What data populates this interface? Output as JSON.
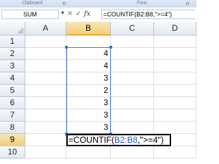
{
  "ribbon": {
    "group_left": "Clipboard",
    "group_mid": "Font"
  },
  "formula_bar": {
    "name_box": "SUM",
    "cancel_glyph": "✕",
    "enter_glyph": "✓",
    "fx_label": "fx",
    "formula": "=COUNTIF(B2:B8,\">=4\")"
  },
  "columns": [
    "A",
    "B",
    "C",
    "D"
  ],
  "rows": [
    "1",
    "2",
    "3",
    "4",
    "5",
    "6",
    "7",
    "8",
    "9",
    "10"
  ],
  "cells": {
    "B2": "4",
    "B3": "4",
    "B4": "3",
    "B5": "2",
    "B6": "3",
    "B7": "3",
    "B8": "3"
  },
  "editing": {
    "prefix": "=COUNTIF(",
    "ref": "B2:B8",
    "suffix": ",\">=4\")"
  },
  "colors": {
    "accent": "#3b6ed8",
    "selected_header": "#f2cf7a",
    "grid": "#d6dde8"
  },
  "icons": {
    "cancel": "cancel-icon",
    "enter": "enter-icon",
    "corner": "select-all-triangle-icon"
  }
}
